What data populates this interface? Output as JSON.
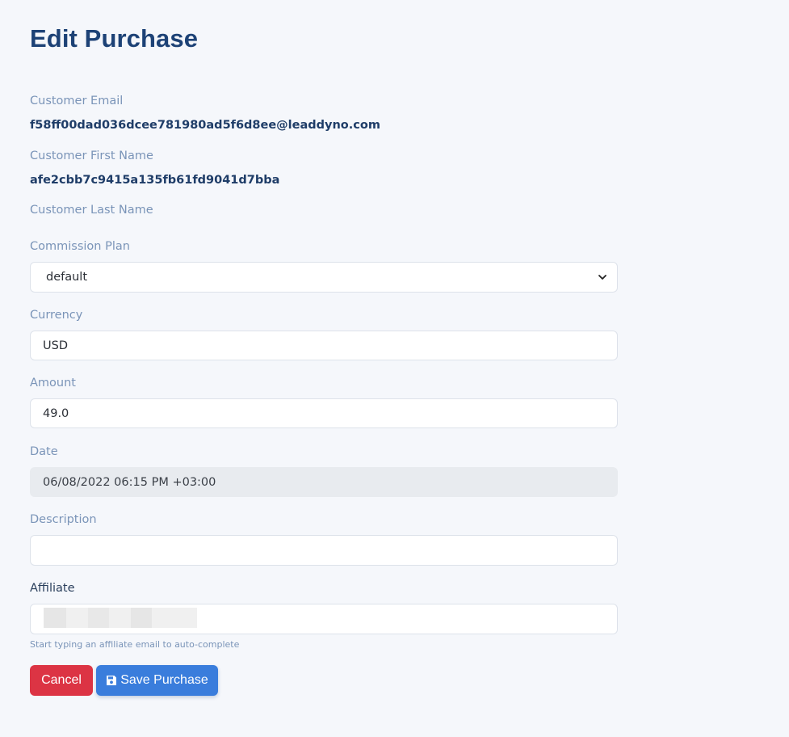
{
  "page": {
    "title": "Edit Purchase"
  },
  "customer": {
    "email_label": "Customer Email",
    "email_value": "f58ff00dad036dcee781980ad5f6d8ee@leaddyno.com",
    "first_name_label": "Customer First Name",
    "first_name_value": "afe2cbb7c9415a135fb61fd9041d7bba",
    "last_name_label": "Customer Last Name"
  },
  "form": {
    "commission_plan": {
      "label": "Commission Plan",
      "selected": "default"
    },
    "currency": {
      "label": "Currency",
      "value": "USD"
    },
    "amount": {
      "label": "Amount",
      "value": "49.0"
    },
    "date": {
      "label": "Date",
      "value": "06/08/2022 06:15 PM +03:00"
    },
    "description": {
      "label": "Description",
      "value": ""
    },
    "affiliate": {
      "label": "Affiliate",
      "hint": "Start typing an affiliate email to auto-complete"
    }
  },
  "actions": {
    "cancel_label": "Cancel",
    "save_label": "Save Purchase"
  },
  "icons": {
    "save": "floppy-disk-icon",
    "select_arrow": "chevron-down-icon"
  },
  "colors": {
    "title": "#1d4276",
    "label": "#7a94b8",
    "cancel": "#dc3444",
    "save": "#3a7ddc",
    "disabled_field": "#e8ebef",
    "background": "#f5f7fb"
  }
}
